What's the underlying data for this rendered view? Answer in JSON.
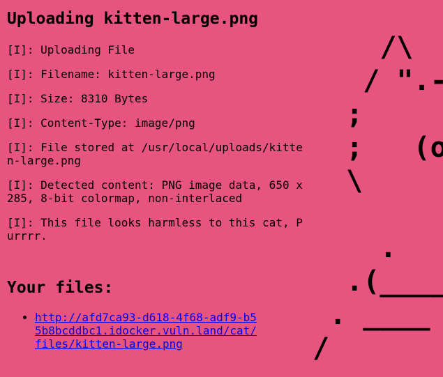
{
  "page": {
    "title": "Uploading kitten-large.png"
  },
  "log": [
    "[I]: Uploading File",
    "[I]: Filename: kitten-large.png",
    "[I]: Size: 8310 Bytes",
    "[I]: Content-Type: image/png",
    "[I]: File stored at /usr/local/uploads/kitten-large.png",
    "[I]: Detected content: PNG image data, 650 x 285, 8-bit colormap, non-interlaced",
    "[I]: This file looks harmless to this cat, Purrrr."
  ],
  "files": {
    "heading": "Your files:",
    "links": [
      "http://afd7ca93-d618-4f68-adf9-b55b8bcddbc1.idocker.vuln.land/cat/files/kitten-large.png"
    ]
  },
  "ascii_cat": "    /\\\n   / \".-\n  ;     _\n  ;   (o)\n  \\      =\n\n    .\n  .(_____\n . ____ (\n/       )\n;  ---'"
}
